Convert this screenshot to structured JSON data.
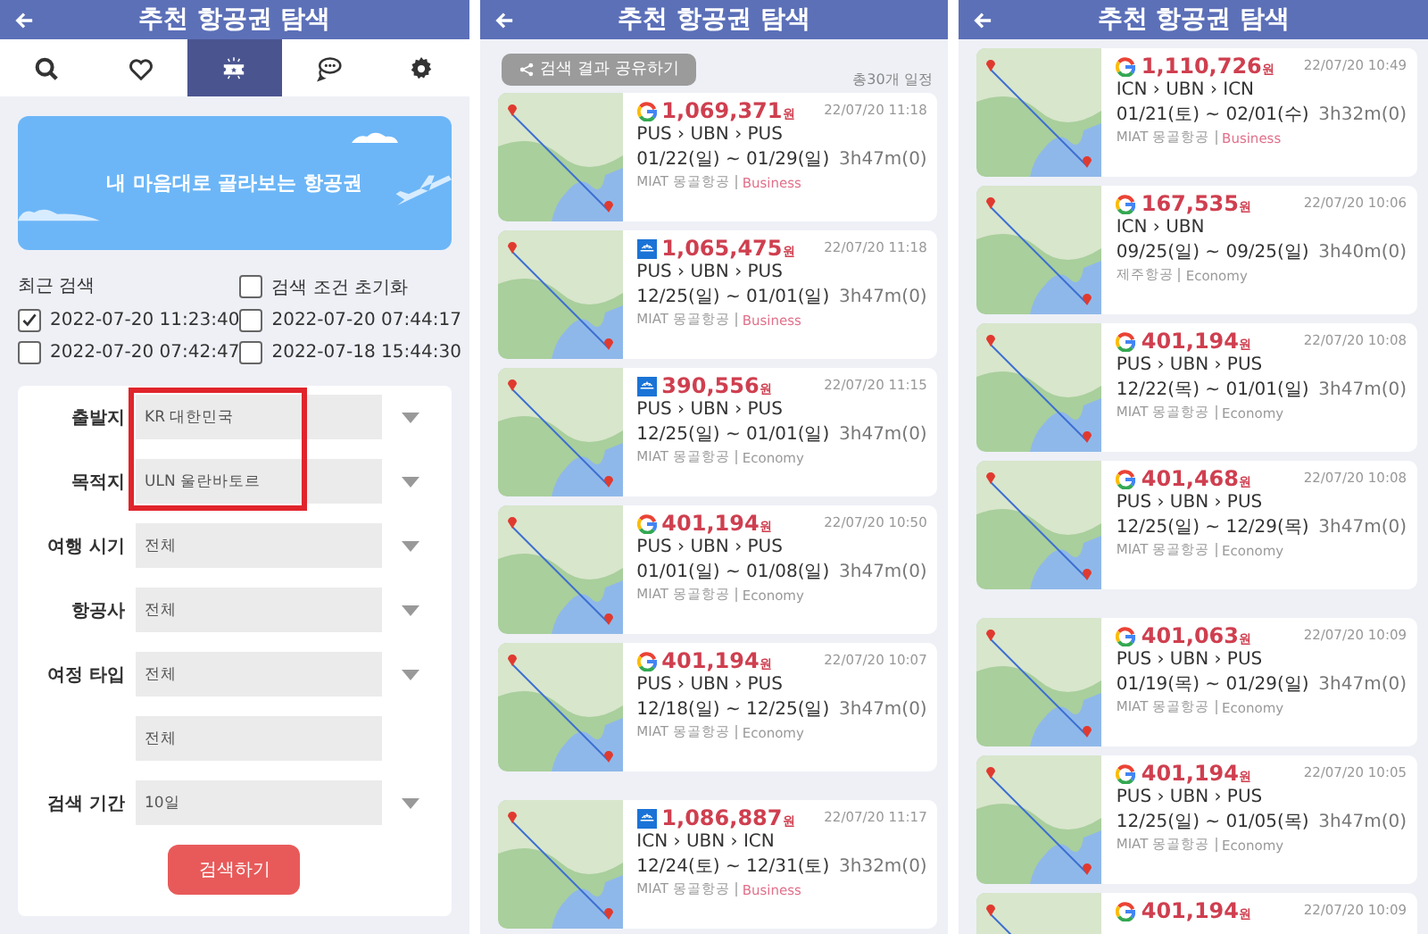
{
  "screens": [
    {
      "kind": "search",
      "title": "추천 항공권 탐색",
      "tabs": [
        {
          "selected": false
        },
        {
          "selected": false
        },
        {
          "selected": true
        },
        {
          "selected": false
        },
        {
          "selected": false
        }
      ],
      "banner": {
        "text": "내 마음대로 골라보는 항공권"
      },
      "recent": {
        "title": "최근 검색",
        "reset": {
          "label": "검색 조건 초기화",
          "checked": false
        },
        "items": [
          {
            "label": "2022-07-20 11:23:40",
            "checked": true
          },
          {
            "label": "2022-07-20 07:44:17",
            "checked": false
          },
          {
            "label": "2022-07-20 07:42:47",
            "checked": false
          },
          {
            "label": "2022-07-18 15:44:30",
            "checked": false
          }
        ]
      },
      "form": {
        "rows": [
          {
            "kind": "select",
            "label": "출발지",
            "value": "KR 대한민국",
            "highlighted": true
          },
          {
            "kind": "select",
            "label": "목적지",
            "value": "ULN 울란바토르",
            "highlighted": true
          },
          {
            "kind": "select",
            "label": "여행 시기",
            "value": "전체",
            "highlighted": false
          },
          {
            "kind": "select",
            "label": "항공사",
            "value": "전체",
            "highlighted": false
          },
          {
            "kind": "select",
            "label": "여정 타입",
            "value": "전체",
            "highlighted": false
          },
          {
            "kind": "plain",
            "value": "전체",
            "highlighted": false
          },
          {
            "kind": "select",
            "label": "검색 기간",
            "value": "10일",
            "highlighted": false
          }
        ],
        "button": "검색하기"
      }
    },
    {
      "kind": "results",
      "title": "추천 항공권 탐색",
      "share": "검색 결과 공유하기",
      "count": "총30개 일정",
      "groups": [
        [
          {
            "kind": "google",
            "price": "1,069,371",
            "unit": "원",
            "time": "22/07/20 11:18",
            "route": "PUS › UBN › PUS",
            "dates": "01/22(일) ~ 01/29(일)",
            "duration": "3h47m(0)",
            "airline": "MIAT 몽골항공",
            "cabin": "Business",
            "color": "#e0708a"
          },
          {
            "kind": "square",
            "price": "1,065,475",
            "unit": "원",
            "time": "22/07/20 11:18",
            "route": "PUS › UBN › PUS",
            "dates": "12/25(일) ~ 01/01(일)",
            "duration": "3h47m(0)",
            "airline": "MIAT 몽골항공",
            "cabin": "Business",
            "color": "#e0708a"
          },
          {
            "kind": "square",
            "price": "390,556",
            "unit": "원",
            "time": "22/07/20 11:15",
            "route": "PUS › UBN › PUS",
            "dates": "12/25(일) ~ 01/01(일)",
            "duration": "3h47m(0)",
            "airline": "MIAT 몽골항공",
            "cabin": "Economy",
            "color": "#999999"
          },
          {
            "kind": "google",
            "price": "401,194",
            "unit": "원",
            "time": "22/07/20 10:50",
            "route": "PUS › UBN › PUS",
            "dates": "01/01(일) ~ 01/08(일)",
            "duration": "3h47m(0)",
            "airline": "MIAT 몽골항공",
            "cabin": "Economy",
            "color": "#999999"
          },
          {
            "kind": "google",
            "price": "401,194",
            "unit": "원",
            "time": "22/07/20 10:07",
            "route": "PUS › UBN › PUS",
            "dates": "12/18(일) ~ 12/25(일)",
            "duration": "3h47m(0)",
            "airline": "MIAT 몽골항공",
            "cabin": "Economy",
            "color": "#999999"
          }
        ],
        [
          {
            "kind": "square",
            "price": "1,086,887",
            "unit": "원",
            "time": "22/07/20 11:17",
            "route": "ICN › UBN › ICN",
            "dates": "12/24(토) ~ 12/31(토)",
            "duration": "3h32m(0)",
            "airline": "MIAT 몽골항공",
            "cabin": "Business",
            "color": "#e0708a"
          }
        ]
      ]
    },
    {
      "kind": "results",
      "title": "추천 항공권 탐색",
      "groups": [
        [
          {
            "kind": "google",
            "price": "1,110,726",
            "unit": "원",
            "time": "22/07/20 10:49",
            "route": "ICN › UBN › ICN",
            "dates": "01/21(토) ~ 02/01(수)",
            "duration": "3h32m(0)",
            "airline": "MIAT 몽골항공",
            "cabin": "Business",
            "color": "#e0708a"
          },
          {
            "kind": "google",
            "price": "167,535",
            "unit": "원",
            "time": "22/07/20 10:06",
            "route": "ICN › UBN",
            "dates": "09/25(일) ~ 09/25(일)",
            "duration": "3h40m(0)",
            "airline": "제주항공",
            "cabin": "Economy",
            "color": "#999999"
          },
          {
            "kind": "google",
            "price": "401,194",
            "unit": "원",
            "time": "22/07/20 10:08",
            "route": "PUS › UBN › PUS",
            "dates": "12/22(목) ~ 01/01(일)",
            "duration": "3h47m(0)",
            "airline": "MIAT 몽골항공",
            "cabin": "Economy",
            "color": "#999999"
          },
          {
            "kind": "google",
            "price": "401,468",
            "unit": "원",
            "time": "22/07/20 10:08",
            "route": "PUS › UBN › PUS",
            "dates": "12/25(일) ~ 12/29(목)",
            "duration": "3h47m(0)",
            "airline": "MIAT 몽골항공",
            "cabin": "Economy",
            "color": "#999999"
          }
        ],
        [
          {
            "kind": "google",
            "price": "401,063",
            "unit": "원",
            "time": "22/07/20 10:09",
            "route": "PUS › UBN › PUS",
            "dates": "01/19(목) ~ 01/29(일)",
            "duration": "3h47m(0)",
            "airline": "MIAT 몽골항공",
            "cabin": "Economy",
            "color": "#999999"
          },
          {
            "kind": "google",
            "price": "401,194",
            "unit": "원",
            "time": "22/07/20 10:05",
            "route": "PUS › UBN › PUS",
            "dates": "12/25(일) ~ 01/05(목)",
            "duration": "3h47m(0)",
            "airline": "MIAT 몽골항공",
            "cabin": "Economy",
            "color": "#999999"
          },
          {
            "kind": "google",
            "price": "401,194",
            "unit": "원",
            "time": "22/07/20 10:09"
          }
        ]
      ]
    }
  ]
}
